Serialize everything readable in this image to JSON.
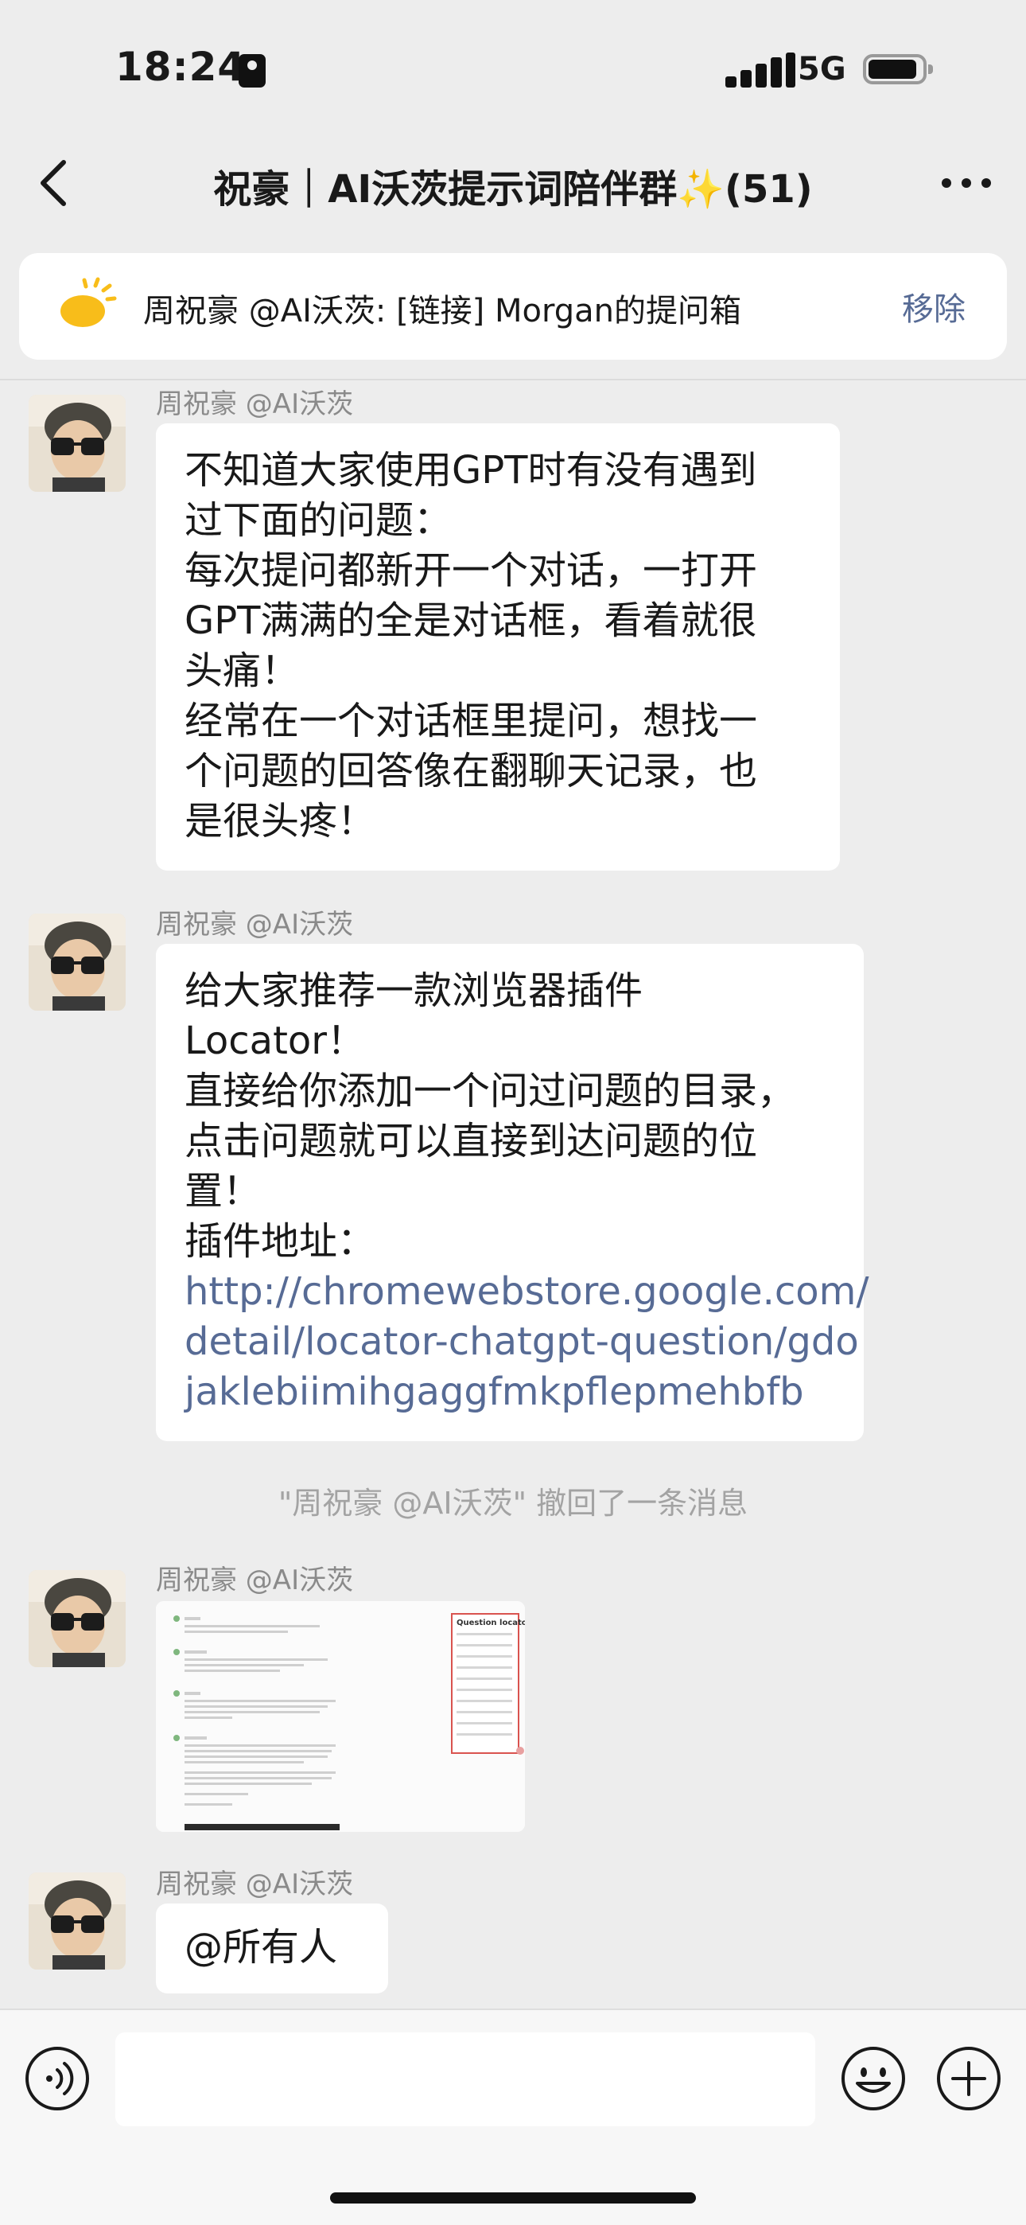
{
  "status_bar": {
    "time": "18:24",
    "network": "5G"
  },
  "nav": {
    "title": "祝豪｜AI沃茨提示词陪伴群✨(51)",
    "back_icon": "chevron-left-icon",
    "more_icon": "more-dots-icon"
  },
  "banner": {
    "icon": "sun-icon",
    "text": "周祝豪 @AI沃茨: [链接] Morgan的提问箱",
    "action": "移除"
  },
  "messages": [
    {
      "sender": "周祝豪 @AI沃茨",
      "lines": [
        "不知道大家使用GPT时有没有遇到",
        "过下面的问题：",
        "每次提问都新开一个对话，一打开",
        "GPT满满的全是对话框，看着就很",
        "头痛！",
        "经常在一个对话框里提问，想找一",
        "个问题的回答像在翻聊天记录，也",
        "是很头疼！"
      ]
    },
    {
      "sender": "周祝豪 @AI沃茨",
      "lines": [
        "给大家推荐一款浏览器插件",
        "Locator！",
        "直接给你添加一个问过问题的目录，",
        "点击问题就可以直接到达问题的位",
        "置！",
        "插件地址："
      ],
      "link_lines": [
        "http://chromewebstore.google.com/",
        "detail/locator-chatgpt-question/gdo",
        "jaklebiimihgaggfmkpflepmehbfb"
      ]
    },
    {
      "sender": "周祝豪 @AI沃茨",
      "image_caption": "Question locator"
    },
    {
      "sender": "周祝豪 @AI沃茨",
      "lines": [
        "@所有人"
      ]
    }
  ],
  "recall_notice": "\"周祝豪 @AI沃茨\" 撤回了一条消息",
  "input_bar": {
    "voice_icon": "voice-icon",
    "emoji_icon": "emoji-icon",
    "plus_icon": "plus-icon",
    "value": ""
  },
  "colors": {
    "background": "#ededed",
    "bubble": "#ffffff",
    "link": "#576b95",
    "meta_text": "#8a8a8a"
  }
}
